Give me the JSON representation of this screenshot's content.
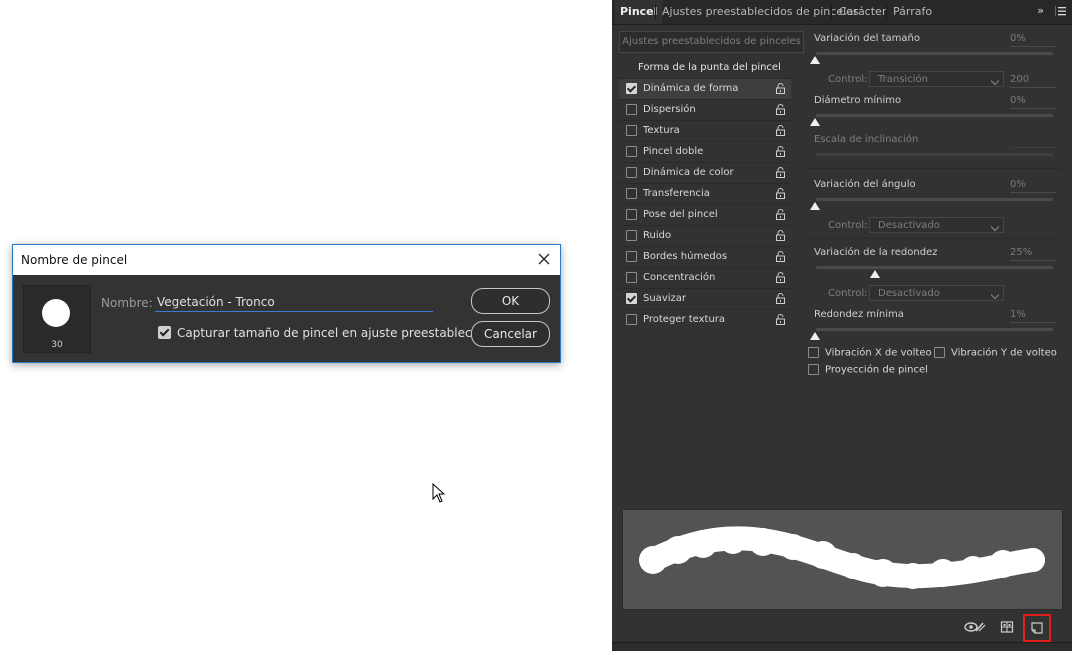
{
  "dialog": {
    "title": "Nombre de pincel",
    "brush_size": "30",
    "name_label": "Nombre:",
    "name_value": "Vegetación - Tronco",
    "capture_label": "Capturar tamaño de pincel en ajuste preestablecido",
    "capture_checked": true,
    "ok_label": "OK",
    "cancel_label": "Cancelar"
  },
  "panel": {
    "tabs": [
      "Pincel",
      "Ajustes preestablecidos de pinceles",
      "Carácter",
      "Párrafo"
    ],
    "active_tab": "Pincel",
    "expand_label": "»",
    "presets_button": "Ajustes preestablecidos de pinceles",
    "options_header": "Forma de la punta del pincel",
    "options": [
      {
        "label": "Dinámica de forma",
        "checked": true,
        "active": true
      },
      {
        "label": "Dispersión",
        "checked": false
      },
      {
        "label": "Textura",
        "checked": false
      },
      {
        "label": "Pincel doble",
        "checked": false
      },
      {
        "label": "Dinámica de color",
        "checked": false
      },
      {
        "label": "Transferencia",
        "checked": false
      },
      {
        "label": "Pose del pincel",
        "checked": false
      },
      {
        "label": "Ruido",
        "checked": false
      },
      {
        "label": "Bordes húmedos",
        "checked": false
      },
      {
        "label": "Concentración",
        "checked": false
      },
      {
        "label": "Suavizar",
        "checked": true
      },
      {
        "label": "Proteger textura",
        "checked": false
      }
    ],
    "size_jitter": {
      "label": "Variación del tamaño",
      "value": "0%",
      "level": 0
    },
    "size_control": {
      "label": "Control:",
      "value": "Transición",
      "amount": "200"
    },
    "min_diameter": {
      "label": "Diámetro mínimo",
      "value": "0%",
      "level": 0
    },
    "tilt_scale": {
      "label": "Escala de inclinación"
    },
    "angle_jitter": {
      "label": "Variación del ángulo",
      "value": "0%",
      "level": 0
    },
    "angle_control": {
      "label": "Control:",
      "value": "Desactivado"
    },
    "roundness_jitter": {
      "label": "Variación de la redondez",
      "value": "25%",
      "level": 25
    },
    "roundness_control": {
      "label": "Control:",
      "value": "Desactivado"
    },
    "min_roundness": {
      "label": "Redondez mínima",
      "value": "1%",
      "level": 1
    },
    "flip_x": "Vibración X de volteo",
    "flip_y": "Vibración Y de volteo",
    "projection": "Proyección de pincel"
  },
  "colors": {
    "panel_bg": "#323232",
    "highlight_box": "#e0201c",
    "dialog_border": "#2b78c9"
  }
}
